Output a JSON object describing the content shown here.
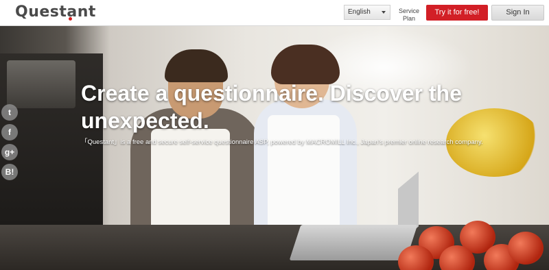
{
  "header": {
    "logo_text": "Questant",
    "language_selected": "English",
    "service_plan_line1": "Service",
    "service_plan_line2": "Plan",
    "try_button": "Try it for free!",
    "signin_button": "Sign In"
  },
  "hero": {
    "headline_line1": "Create a questionnaire. Discover the",
    "headline_line2": "unexpected.",
    "subline": "「Questant」is a free and secure self-service questionnaire ASP, powered by MACROMILL Inc., Japan's premier online research company."
  },
  "social": [
    {
      "icon": "twitter-icon",
      "glyph": "t"
    },
    {
      "icon": "facebook-icon",
      "glyph": "f"
    },
    {
      "icon": "google-plus-icon",
      "glyph": "g+"
    },
    {
      "icon": "hatena-bookmark-icon",
      "glyph": "B!"
    }
  ],
  "colors": {
    "brand_red": "#d21f26",
    "logo_gray": "#4a4a4a"
  }
}
